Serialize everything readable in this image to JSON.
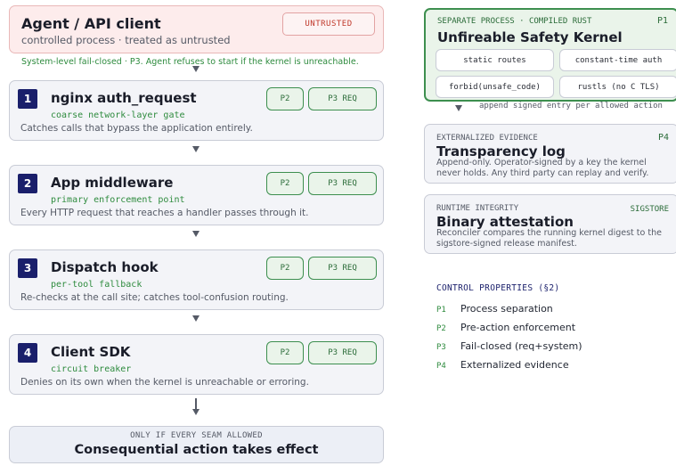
{
  "agent": {
    "title": "Agent / API client",
    "subtitle": "controlled process · treated as untrusted",
    "badge": "UNTRUSTED"
  },
  "fail_closed_note": "System-level fail-closed · P3. Agent refuses to start if the kernel is unreachable.",
  "stages": [
    {
      "number": "1",
      "title": "nginx auth_request",
      "mono": "coarse network-layer gate",
      "desc": "Catches calls that bypass the application entirely.",
      "pill_a": "P2",
      "pill_b": "P3 REQ"
    },
    {
      "number": "2",
      "title": "App middleware",
      "mono": "primary enforcement point",
      "desc": "Every HTTP request that reaches a handler passes through it.",
      "pill_a": "P2",
      "pill_b": "P3 REQ"
    },
    {
      "number": "3",
      "title": "Dispatch hook",
      "mono": "per-tool fallback",
      "desc": "Re-checks at the call site; catches tool-confusion routing.",
      "pill_a": "P2",
      "pill_b": "P3 REQ"
    },
    {
      "number": "4",
      "title": "Client SDK",
      "mono": "circuit breaker",
      "desc": "Denies on its own when the kernel is unreachable or erroring.",
      "pill_a": "P2",
      "pill_b": "P3 REQ"
    }
  ],
  "final": {
    "kicker": "ONLY IF EVERY SEAM ALLOWED",
    "title": "Consequential action takes effect"
  },
  "kernel": {
    "kicker": "SEPARATE PROCESS · COMPILED RUST",
    "tag": "P1",
    "title": "Unfireable Safety Kernel",
    "features": [
      "static routes",
      "constant-time auth",
      "forbid(unsafe_code)",
      "rustls (no C TLS)"
    ]
  },
  "append_note": "append signed entry per allowed action",
  "transparency": {
    "kicker": "EXTERNALIZED EVIDENCE",
    "tag": "P4",
    "title": "Transparency log",
    "desc": "Append-only. Operator-signed by a key the kernel never holds. Any third party can replay and verify."
  },
  "attestation": {
    "kicker": "RUNTIME INTEGRITY",
    "tag": "SIGSTORE",
    "title": "Binary attestation",
    "desc": "Reconciler compares the running kernel digest to the sigstore-signed release manifest."
  },
  "properties": {
    "title": "CONTROL PROPERTIES (§2)",
    "items": [
      {
        "id": "P1",
        "label": "Process separation"
      },
      {
        "id": "P2",
        "label": "Pre-action enforcement"
      },
      {
        "id": "P3",
        "label": "Fail-closed (req+system)"
      },
      {
        "id": "P4",
        "label": "Externalized evidence"
      }
    ]
  },
  "colors": {
    "accent_navy": "#1a1f6b",
    "accent_green": "#3d8f4f",
    "untrusted_red": "#c0392b"
  }
}
